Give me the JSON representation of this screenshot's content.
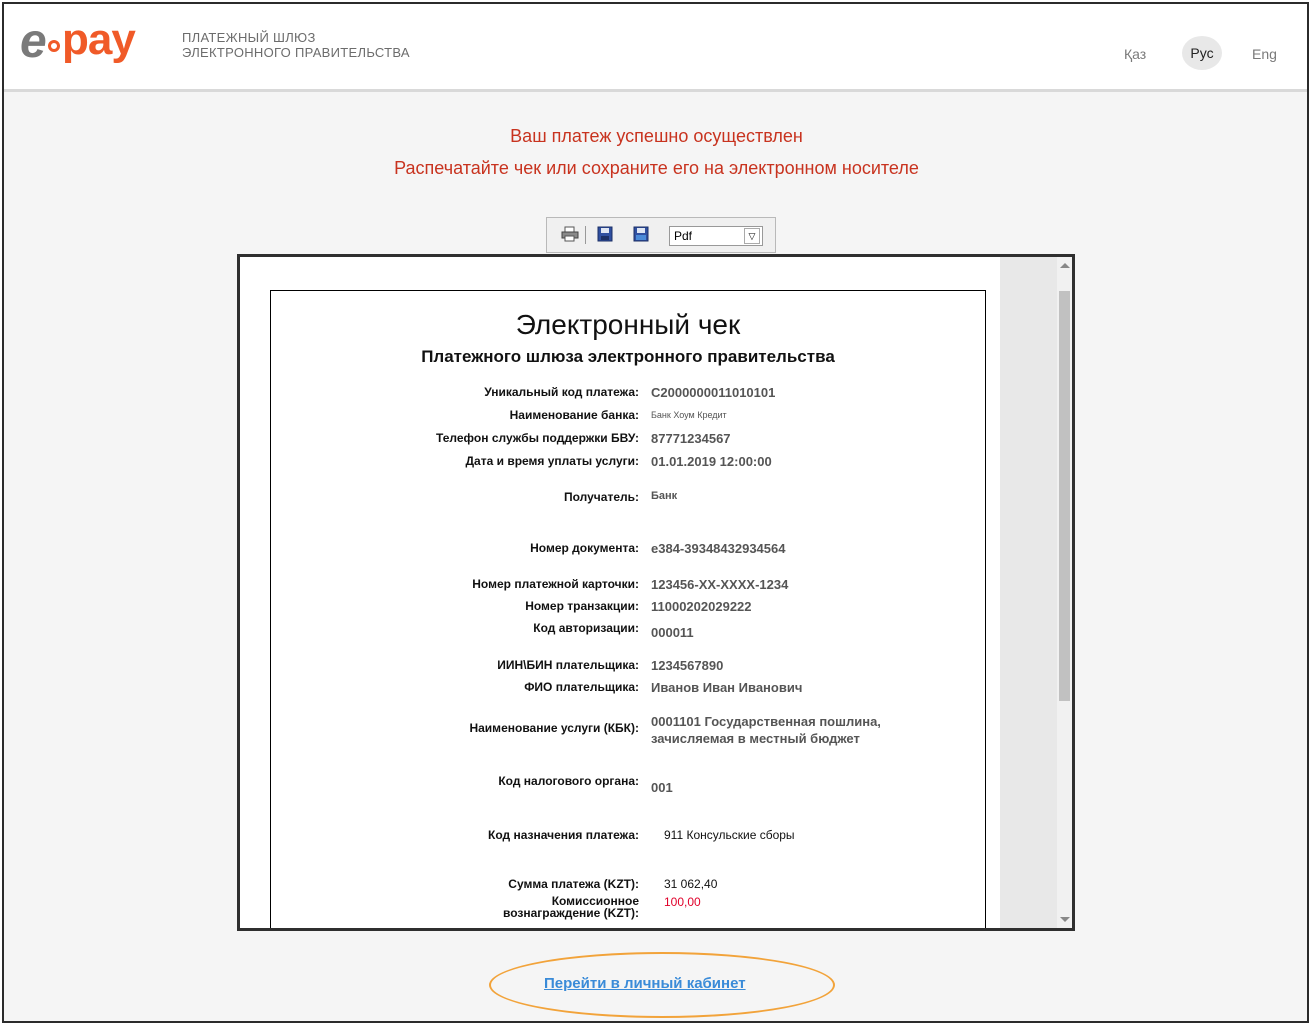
{
  "header": {
    "logo_e": "e",
    "logo_pay": "pay",
    "subtitle_line1": "ПЛАТЕЖНЫЙ ШЛЮЗ",
    "subtitle_line2": "ЭЛЕКТРОННОГО ПРАВИТЕЛЬСТВА",
    "languages": [
      "Қаз",
      "Рус",
      "Eng"
    ],
    "active_language": "Рус"
  },
  "status": {
    "message": "Ваш платеж успешно осуществлен",
    "instruction": "Распечатайте чек или сохраните его на электронном носителе",
    "color": "#c8331f"
  },
  "toolbar": {
    "icons": [
      "print-icon",
      "save-icon",
      "save-as-icon"
    ],
    "format_selected": "Pdf"
  },
  "receipt": {
    "title": "Электронный чек",
    "subtitle": "Платежного шлюза электронного правительства",
    "fields": [
      {
        "label": "Уникальный код платежа:",
        "value": "C2000000011010101"
      },
      {
        "label": "Наименование банка:",
        "value": "Банк Хоум Кредит"
      },
      {
        "label": "Телефон службы поддержки БВУ:",
        "value": "87771234567"
      },
      {
        "label": "Дата и время уплаты услуги:",
        "value": "01.01.2019 12:00:00"
      },
      {
        "label": "Получатель:",
        "value": "Банк"
      },
      {
        "label": "Номер документа:",
        "value": "e384-39348432934564"
      },
      {
        "label": "Номер платежной карточки:",
        "value": "123456-XX-XXXX-1234"
      },
      {
        "label": "Номер транзакции:",
        "value": "11000202029222"
      },
      {
        "label": "Код авторизации:",
        "value": "000011"
      },
      {
        "label": "ИИН\\БИН плательщика:",
        "value": "1234567890"
      },
      {
        "label": "ФИО плательщика:",
        "value": "Иванов Иван Иванович"
      },
      {
        "label": "Наименование услуги (КБК):",
        "value": "0001101 Государственная пошлина, зачисляемая в местный бюджет"
      },
      {
        "label": "Код налогового органа:",
        "value": "001"
      },
      {
        "label": "Код назначения платежа:",
        "value": "911 Консульские сборы"
      },
      {
        "label": "Сумма платежа (KZT):",
        "value": "31 062,40"
      },
      {
        "label_line1": "Комиссионное",
        "label_line2": "вознаграждение (KZT):",
        "value": "100,00"
      }
    ],
    "commission_color": "#e0002a"
  },
  "footer": {
    "cabinet_link": "Перейти в личный кабинет"
  },
  "colors": {
    "brand_orange": "#f05a28",
    "link_blue": "#3a8bd8",
    "highlight_ring": "#f2a33a"
  }
}
